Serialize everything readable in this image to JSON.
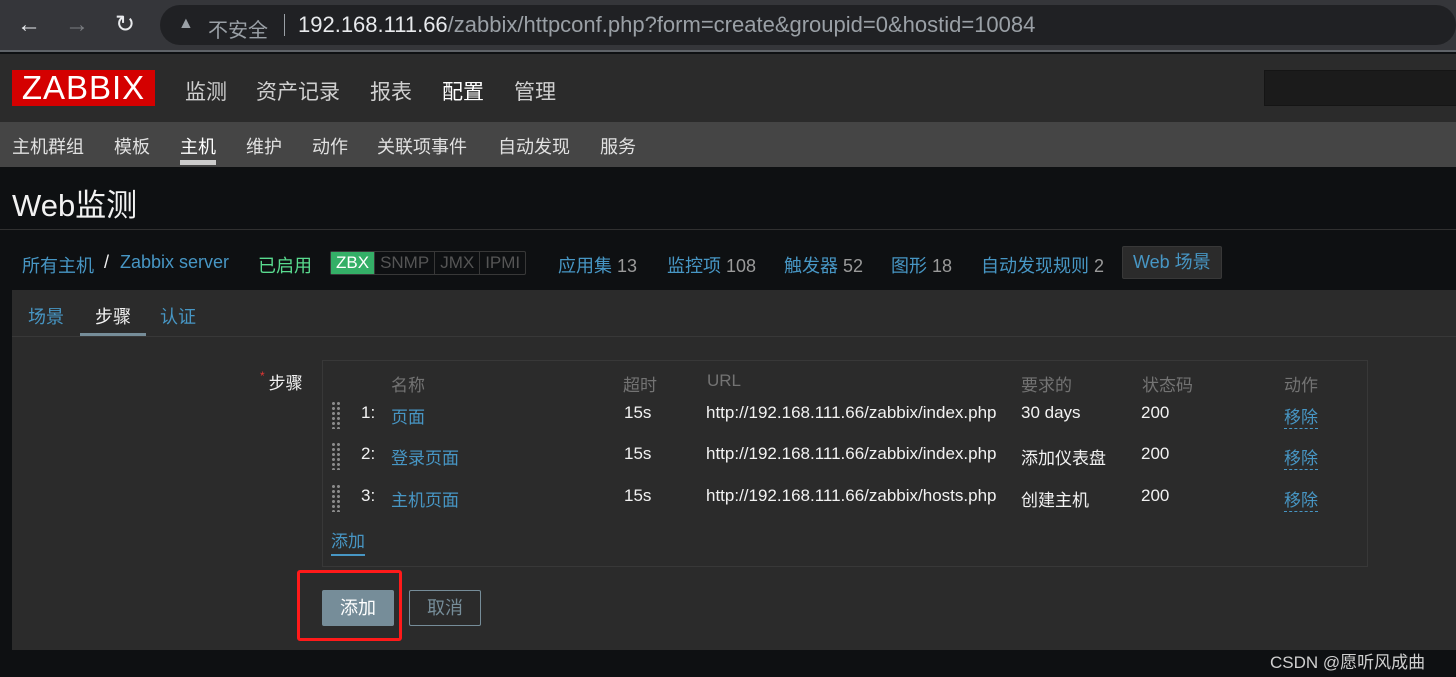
{
  "browser": {
    "back": "←",
    "forward": "→",
    "reload": "↻",
    "security_label": "不安全",
    "url_host": "192.168.111.66",
    "url_path": "/zabbix/httpconf.php?form=create&groupid=0&hostid=10084"
  },
  "header": {
    "logo": "ZABBIX",
    "menu": [
      "监测",
      "资产记录",
      "报表",
      "配置",
      "管理"
    ],
    "active_menu": "配置"
  },
  "submenu": {
    "items": [
      "主机群组",
      "模板",
      "主机",
      "维护",
      "动作",
      "关联项事件",
      "自动发现",
      "服务"
    ],
    "active": "主机"
  },
  "page_title": "Web监测",
  "breadcrumb": {
    "all_hosts": "所有主机",
    "separator": "/",
    "host": "Zabbix server",
    "status": "已启用",
    "availability": [
      "ZBX",
      "SNMP",
      "JMX",
      "IPMI"
    ],
    "links": [
      {
        "label": "应用集",
        "count": "13"
      },
      {
        "label": "监控项",
        "count": "108"
      },
      {
        "label": "触发器",
        "count": "52"
      },
      {
        "label": "图形",
        "count": "18"
      },
      {
        "label": "自动发现规则",
        "count": "2"
      }
    ],
    "web_tab": "Web 场景"
  },
  "tabs": [
    "场景",
    "步骤",
    "认证"
  ],
  "active_tab": "步骤",
  "steps": {
    "label": "步骤",
    "columns": [
      "名称",
      "超时",
      "URL",
      "要求的",
      "状态码",
      "动作"
    ],
    "rows": [
      {
        "num": "1:",
        "name": "页面",
        "timeout": "15s",
        "url": "http://192.168.111.66/zabbix/index.php",
        "required": "30 days",
        "status": "200",
        "action": "移除"
      },
      {
        "num": "2:",
        "name": "登录页面",
        "timeout": "15s",
        "url": "http://192.168.111.66/zabbix/index.php",
        "required": "添加仪表盘",
        "status": "200",
        "action": "移除"
      },
      {
        "num": "3:",
        "name": "主机页面",
        "timeout": "15s",
        "url": "http://192.168.111.66/zabbix/hosts.php",
        "required": "创建主机",
        "status": "200",
        "action": "移除"
      }
    ],
    "add_link": "添加"
  },
  "buttons": {
    "add": "添加",
    "cancel": "取消"
  },
  "watermark": "CSDN @愿听风成曲",
  "colors": {
    "link": "#4796c4",
    "logo": "#d40000",
    "enabled": "#59db8f",
    "zbx": "#34af67",
    "button": "#768d99",
    "highlight": "#ff1a1a"
  }
}
